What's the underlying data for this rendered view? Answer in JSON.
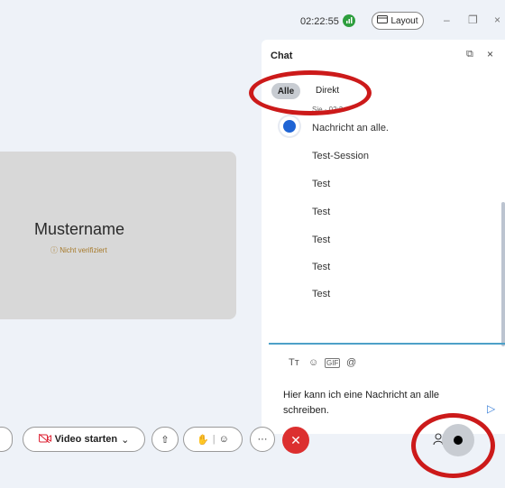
{
  "topbar": {
    "time": "02:22:55",
    "layout_label": "Layout",
    "minimize": "–",
    "restore": "❐",
    "close": "×"
  },
  "tile": {
    "name": "Mustername",
    "verify_icon": "ⓘ",
    "verify_label": "Nicht verifiziert"
  },
  "chat": {
    "title": "Chat",
    "popout": "⧉",
    "close": "×",
    "tabs": [
      {
        "label": "Alle",
        "active": true
      },
      {
        "label": "Direkt",
        "active": false
      }
    ],
    "sender_line": "Sie · 02:2",
    "messages": [
      "Nachricht an alle.",
      "Test-Session",
      "Test",
      "Test",
      "Test",
      "Test",
      "Test"
    ],
    "format_icons": [
      "Tт",
      "☺",
      "GIF",
      "@"
    ],
    "compose_text": "Hier kann ich eine Nachricht an alle schreiben.",
    "send_icon": "▷"
  },
  "toolbar": {
    "video_label": "Video starten",
    "video_chevron": "⌄",
    "share_icon": "⇧",
    "hand_icon": "✋",
    "reaction_icon": "☺",
    "more_icon": "···",
    "end_icon": "✕",
    "people_icon": "👤"
  },
  "colors": {
    "accent_red": "#cc1a1a",
    "end_call": "#dc2f2f",
    "avatar_blue": "#1f64d4",
    "verify": "#a77a2a",
    "input_line": "#4da0c8"
  }
}
